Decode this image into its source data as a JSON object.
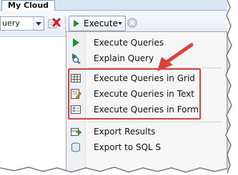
{
  "tabs": [
    {
      "label": "My Cloud"
    }
  ],
  "toolbar": {
    "combo_value": "uery",
    "execute_label": "Execute"
  },
  "menu": {
    "items": [
      {
        "label": "Execute Queries",
        "icon": "play-icon"
      },
      {
        "label": "Explain Query",
        "icon": "explain-icon"
      },
      {
        "label": "Execute Queries in Grid",
        "icon": "grid-icon"
      },
      {
        "label": "Execute Queries in Text",
        "icon": "text-icon"
      },
      {
        "label": "Execute Queries in Form",
        "icon": "form-icon"
      },
      {
        "label": "Export Results",
        "icon": "export-icon"
      },
      {
        "label": "Export to SQL S",
        "icon": "export-sql-icon"
      }
    ]
  },
  "colors": {
    "highlight": "#e0403a",
    "play_green": "#2b8a2b",
    "delete_red": "#d42020"
  }
}
